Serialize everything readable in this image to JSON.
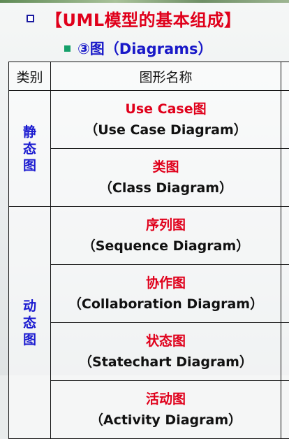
{
  "title": "【UML模型的基本组成】",
  "subtitle": "③图（Diagrams）",
  "table": {
    "headers": [
      "类别",
      "图形名称"
    ],
    "groups": [
      {
        "category": [
          "静",
          "态",
          "图"
        ],
        "rows": [
          {
            "cn": "Use Case图",
            "en": "（Use Case Diagram）"
          },
          {
            "cn": "类图",
            "en": "（Class Diagram）"
          }
        ]
      },
      {
        "category": [
          "动",
          "态",
          "图"
        ],
        "rows": [
          {
            "cn": "序列图",
            "en": "（Sequence Diagram）"
          },
          {
            "cn": "协作图",
            "en": "（Collaboration Diagram）"
          },
          {
            "cn": "状态图",
            "en": "（Statechart Diagram）"
          },
          {
            "cn": "活动图",
            "en": "（Activity Diagram）"
          }
        ]
      }
    ]
  },
  "colors": {
    "title": "#e0001b",
    "subtitle": "#1919c8",
    "category": "#1a1ad0",
    "bullet_solid": "#15a06a",
    "bullet_hollow": "#1a1aa0"
  }
}
